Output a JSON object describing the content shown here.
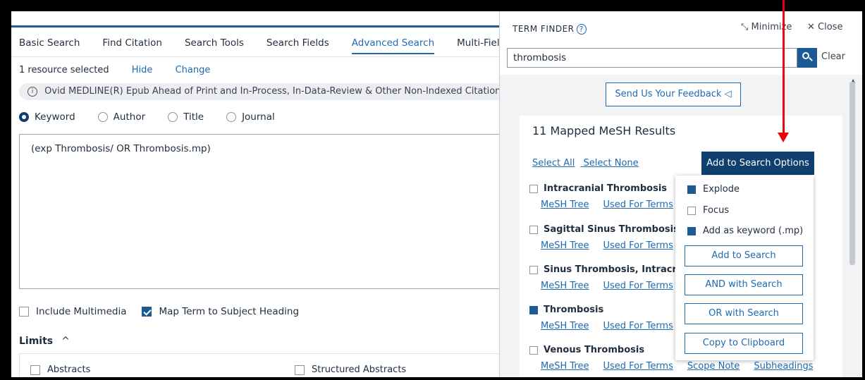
{
  "main": {
    "tabs": [
      {
        "label": "Basic Search"
      },
      {
        "label": "Find Citation"
      },
      {
        "label": "Search Tools"
      },
      {
        "label": "Search Fields"
      },
      {
        "label": "Advanced Search"
      },
      {
        "label": "Multi-Field Sea"
      }
    ],
    "resource": {
      "text": "1 resource selected",
      "hide": "Hide",
      "change": "Change"
    },
    "database": "Ovid MEDLINE(R) Epub Ahead of Print and In-Process, In-Data-Review & Other Non-Indexed Citations an",
    "radios": [
      {
        "label": "Keyword"
      },
      {
        "label": "Author"
      },
      {
        "label": "Title"
      },
      {
        "label": "Journal"
      }
    ],
    "query": "(exp Thrombosis/ OR Thrombosis.mp)",
    "options": [
      {
        "label": "Include Multimedia"
      },
      {
        "label": "Map Term to Subject Heading"
      }
    ],
    "limits_label": "Limits",
    "limits_chevron": "^",
    "limit_items": [
      {
        "label": "Abstracts"
      },
      {
        "label": "Structured Abstracts"
      }
    ]
  },
  "term_finder": {
    "title": "TERM FINDER",
    "help": "?",
    "minimize": "Minimize",
    "close": "Close",
    "search_value": "thrombosis",
    "clear": "Clear",
    "feedback": "Send Us Your Feedback",
    "results_title": "11 Mapped MeSH Results",
    "select_all": "Select All",
    "select_none": "Select None",
    "add_options": "Add to Search Options",
    "terms": [
      {
        "name": "Intracranial Thrombosis",
        "links": [
          "MeSH Tree",
          "Used For Terms"
        ]
      },
      {
        "name": "Sagittal Sinus Thrombosis",
        "links": [
          "MeSH Tree",
          "Used For Terms"
        ]
      },
      {
        "name": "Sinus Thrombosis, Intracrania",
        "links": [
          "MeSH Tree",
          "Used For Terms"
        ]
      },
      {
        "name": "Thrombosis",
        "links": [
          "MeSH Tree",
          "Used For Terms"
        ]
      },
      {
        "name": "Venous Thrombosis",
        "links": [
          "MeSH Tree",
          "Used For Terms",
          "Scope Note",
          "Subheadings"
        ]
      }
    ],
    "dropdown": {
      "checks": [
        {
          "label": "Explode"
        },
        {
          "label": "Focus"
        },
        {
          "label": "Add as keyword (.mp)"
        }
      ],
      "buttons": [
        {
          "label": "Add to Search"
        },
        {
          "label": "AND with Search"
        },
        {
          "label": "OR with Search"
        },
        {
          "label": "Copy to Clipboard"
        }
      ]
    }
  },
  "colors": {
    "accent": "#1d6ab1",
    "dark_button": "#0f3f6e",
    "annotation_arrow": "#e8000b"
  }
}
